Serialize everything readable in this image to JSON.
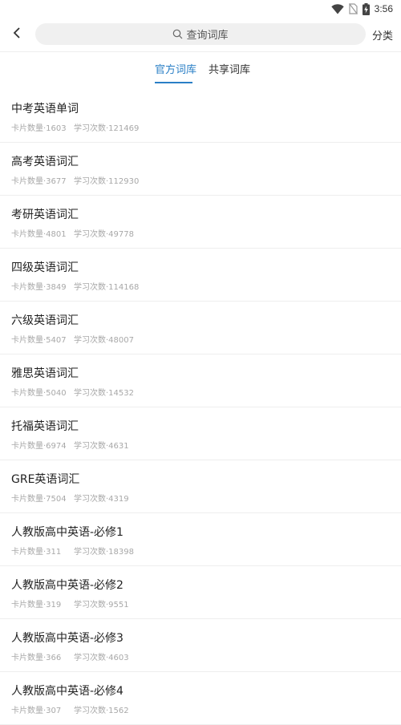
{
  "status_bar": {
    "time": "3:56",
    "icons": [
      "wifi-icon",
      "no-sim-icon",
      "battery-charging-icon"
    ]
  },
  "app_bar": {
    "back_icon": "chevron-left-icon",
    "search_icon": "search-icon",
    "search_placeholder": "查询词库",
    "category_label": "分类"
  },
  "tabs": [
    {
      "label": "官方词库",
      "active": true
    },
    {
      "label": "共享词库",
      "active": false
    }
  ],
  "colors": {
    "accent": "#2a7fc6",
    "meta_text": "#a8a8a8",
    "search_bg": "#f0f0f0"
  },
  "wordbooks": [
    {
      "title": "中考英语单词",
      "cards": "卡片数量·1603",
      "studies": "学习次数·121469"
    },
    {
      "title": "高考英语词汇",
      "cards": "卡片数量·3677",
      "studies": "学习次数·112930"
    },
    {
      "title": "考研英语词汇",
      "cards": "卡片数量·4801",
      "studies": "学习次数·49778"
    },
    {
      "title": "四级英语词汇",
      "cards": "卡片数量·3849",
      "studies": "学习次数·114168"
    },
    {
      "title": "六级英语词汇",
      "cards": "卡片数量·5407",
      "studies": "学习次数·48007"
    },
    {
      "title": "雅思英语词汇",
      "cards": "卡片数量·5040",
      "studies": "学习次数·14532"
    },
    {
      "title": "托福英语词汇",
      "cards": "卡片数量·6974",
      "studies": "学习次数·4631"
    },
    {
      "title": "GRE英语词汇",
      "cards": "卡片数量·7504",
      "studies": "学习次数·4319"
    },
    {
      "title": "人教版高中英语-必修1",
      "cards": "卡片数量·311",
      "studies": "学习次数·18398"
    },
    {
      "title": "人教版高中英语-必修2",
      "cards": "卡片数量·319",
      "studies": "学习次数·9551"
    },
    {
      "title": "人教版高中英语-必修3",
      "cards": "卡片数量·366",
      "studies": "学习次数·4603"
    },
    {
      "title": "人教版高中英语-必修4",
      "cards": "卡片数量·307",
      "studies": "学习次数·1562"
    }
  ]
}
